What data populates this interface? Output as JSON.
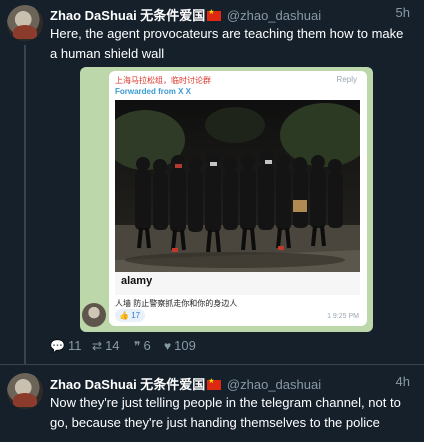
{
  "tweets": [
    {
      "name": "Zhao DaShuai 无条件爱国",
      "handle": "@zhao_dashuai",
      "time": "5h",
      "text": "Here, the agent provocateurs are teaching them how to make a human shield wall",
      "stats": {
        "replies": "11",
        "retweets": "14",
        "quotes": "6",
        "likes": "109"
      }
    },
    {
      "name": "Zhao DaShuai 无条件爱国",
      "handle": "@zhao_dashuai",
      "time": "4h",
      "text": "Now they're just telling people in the telegram channel, not to go, because they're just handing themselves to the police"
    }
  ],
  "embed": {
    "channel": "上海马拉松组，临时讨论群",
    "reply": "Reply",
    "forwarded": "Forwarded from X X",
    "watermark": "alamy",
    "caption": "人墙 防止警察抓走你和你的身边人",
    "reaction_count": "17",
    "meta": "1 9:25 PM"
  },
  "icons": {
    "reply": "reply-icon",
    "retweet": "retweet-icon",
    "quote": "quote-icon",
    "like": "heart-icon"
  },
  "colors": {
    "background": "#15202b",
    "muted": "#8899a6",
    "accent_red": "#d9352a",
    "link_blue": "#3a9bd5"
  }
}
